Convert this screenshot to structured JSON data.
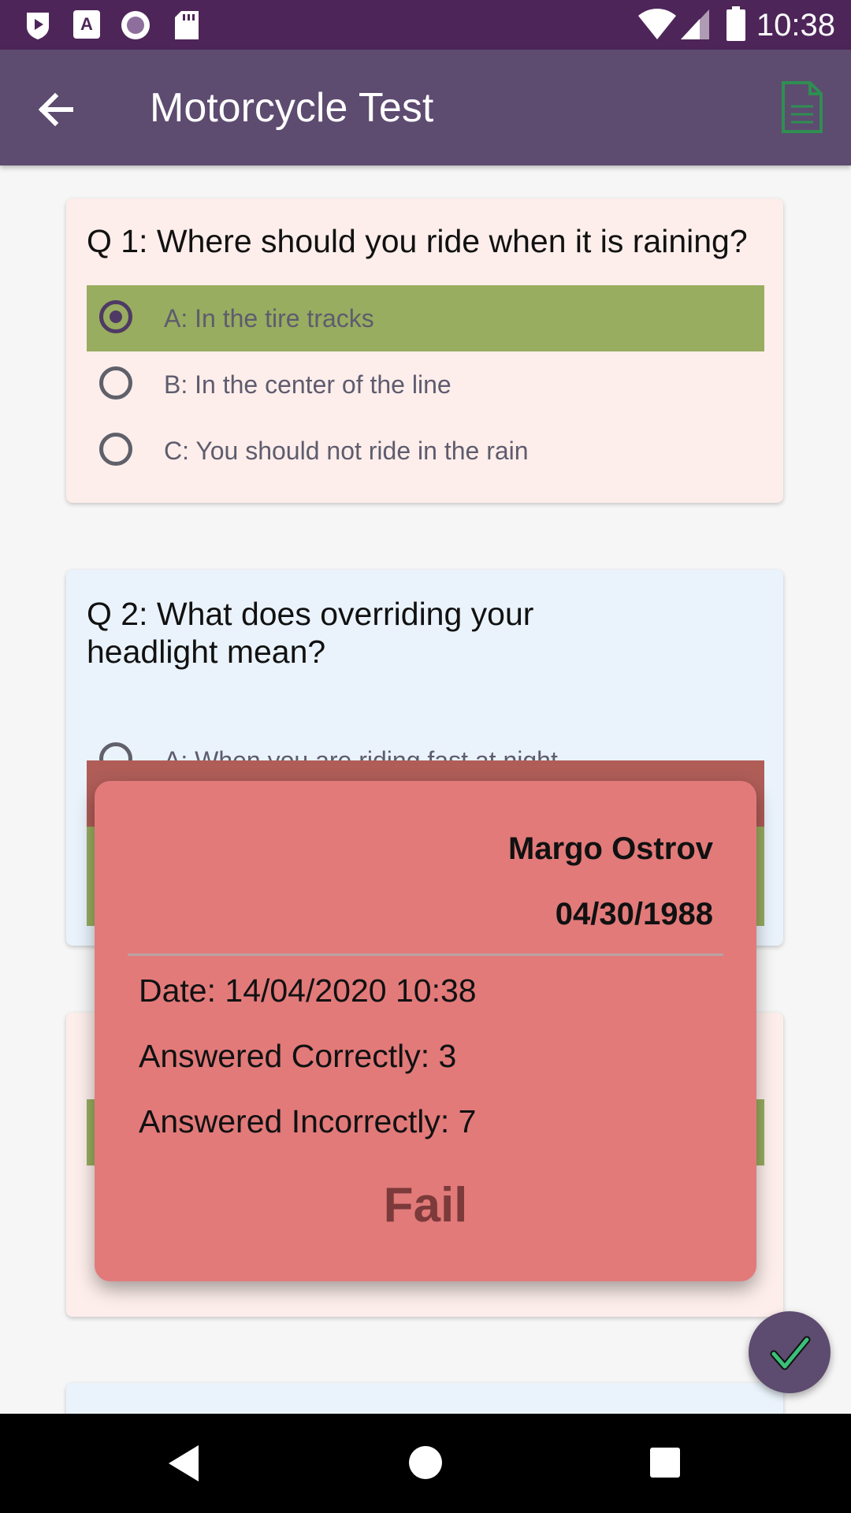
{
  "status_bar": {
    "time": "10:38",
    "icons": [
      "play-shield-icon",
      "font-a-icon",
      "circle-record-icon",
      "sd-card-icon",
      "wifi-icon",
      "signal-icon",
      "battery-icon"
    ]
  },
  "app_bar": {
    "title": "Motorcycle Test",
    "back_icon": "arrow-back-icon",
    "action_icon": "document-icon"
  },
  "questions": [
    {
      "text": "Q 1: Where should you ride when it is raining?",
      "options": [
        {
          "label": "A: In the tire tracks",
          "selected": true,
          "state": "correct"
        },
        {
          "label": "B: In the center of the line",
          "selected": false
        },
        {
          "label": "C: You should not ride in the rain",
          "selected": false
        }
      ]
    },
    {
      "text": "Q 2: What does overriding your headlight mean?",
      "options": [
        {
          "label": "A: When you are riding fast at night",
          "selected": false
        }
      ]
    }
  ],
  "result_dialog": {
    "name": "Margo Ostrov",
    "dob": "04/30/1988",
    "date": "Date: 14/04/2020 10:38",
    "correct": "Answered Correctly: 3",
    "incorrect": "Answered Incorrectly: 7",
    "result": "Fail"
  },
  "fab": {
    "icon": "checkmark-icon"
  },
  "nav_bar": {
    "icons": [
      "back-triangle-icon",
      "home-circle-icon",
      "recents-square-icon"
    ]
  },
  "colors": {
    "status_bar": "#4E2559",
    "app_bar": "#5E4B70",
    "correct_option": "#98AD5F",
    "wrong_option": "#B05D58",
    "dialog": "#E27A7A",
    "fail_text": "#7C3A3A"
  }
}
